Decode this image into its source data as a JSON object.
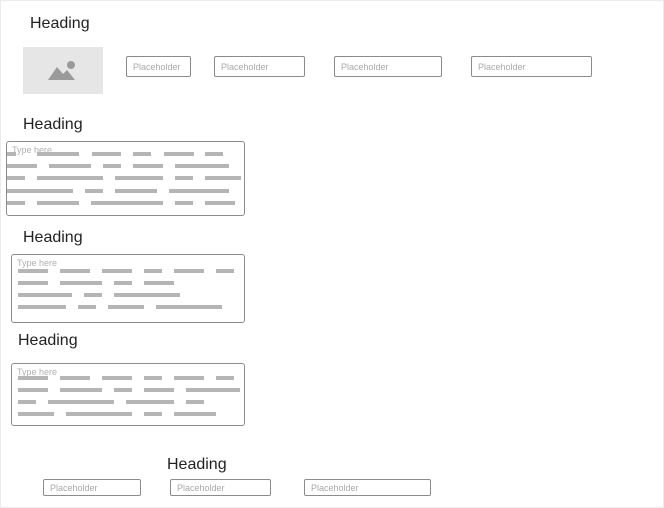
{
  "headings": {
    "h1": "Heading",
    "h2": "Heading",
    "h3": "Heading",
    "h4": "Heading",
    "h5": "Heading"
  },
  "image_placeholder": {
    "icon": "image-icon"
  },
  "top_row_inputs": [
    {
      "placeholder": "Placeholder"
    },
    {
      "placeholder": "Placeholder"
    },
    {
      "placeholder": "Placeholder"
    },
    {
      "placeholder": "Placeholder"
    }
  ],
  "textareas": [
    {
      "hint": "Type here"
    },
    {
      "hint": "Type here"
    },
    {
      "hint": "Type here"
    }
  ],
  "bottom_row_inputs": [
    {
      "placeholder": "Placeholder"
    },
    {
      "placeholder": "Placeholder"
    },
    {
      "placeholder": "Placeholder"
    }
  ],
  "colors": {
    "border": "#8c8c8c",
    "text_line": "#b5b5b5",
    "image_bg": "#e6e6e6",
    "icon": "#9a9a9a"
  }
}
